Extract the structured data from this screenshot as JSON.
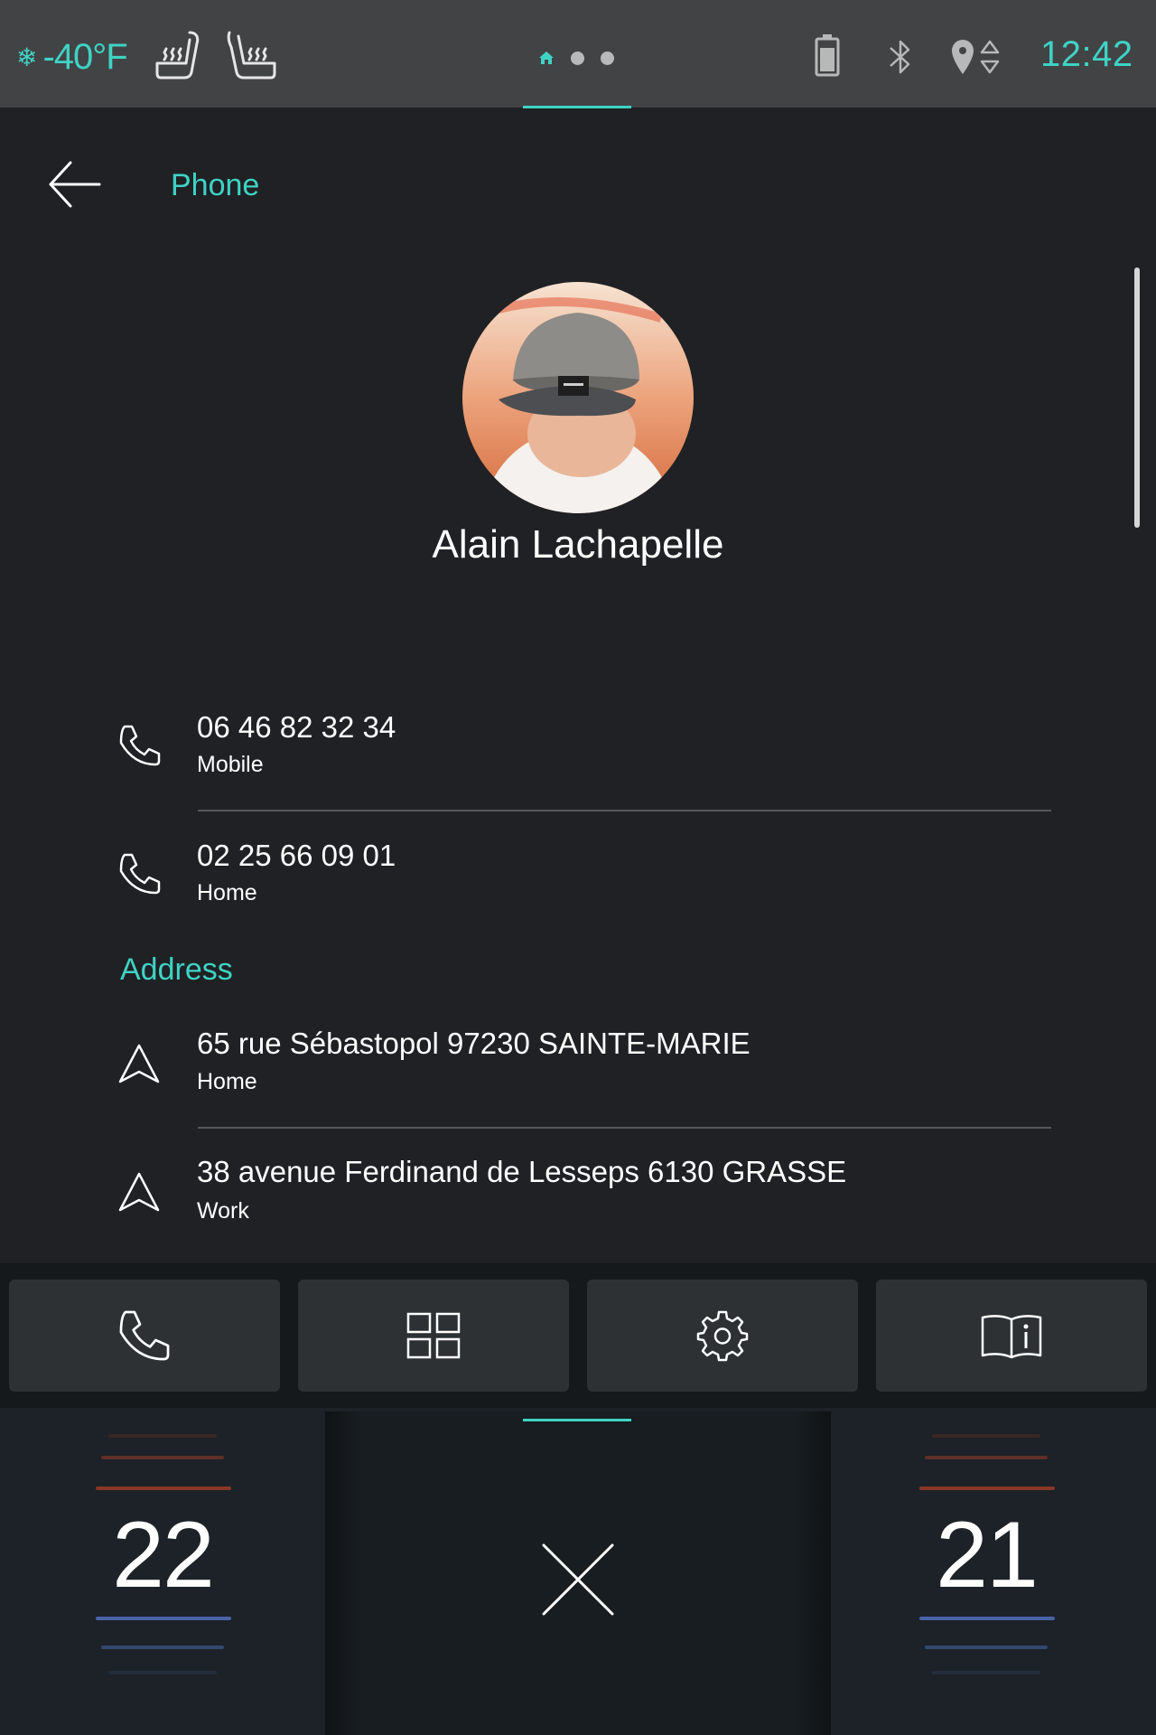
{
  "status_bar": {
    "outside_temp": "-40°F",
    "clock": "12:42",
    "pages": 3,
    "active_page": 1,
    "icons": [
      "snowflake-icon",
      "heated-seat-icon",
      "heated-seat-icon",
      "home-icon",
      "battery-icon",
      "bluetooth-icon",
      "location-icon"
    ]
  },
  "header": {
    "title": "Phone"
  },
  "contact": {
    "name": "Alain Lachapelle",
    "phones": [
      {
        "number": "06 46 82 32 34",
        "type": "Mobile"
      },
      {
        "number": "02 25 66 09 01",
        "type": "Home"
      }
    ],
    "address_section_title": "Address",
    "addresses": [
      {
        "line": "65 rue Sébastopol 97230 SAINTE-MARIE",
        "type": "Home"
      },
      {
        "line": "38 avenue Ferdinand de Lesseps 6130 GRASSE",
        "type": "Work"
      }
    ]
  },
  "dock": {
    "buttons": [
      "phone-icon",
      "apps-grid-icon",
      "settings-gear-icon",
      "manual-book-icon"
    ]
  },
  "climate": {
    "left_temp": "22",
    "right_temp": "21",
    "center_icon": "close-icon"
  },
  "colors": {
    "accent": "#3fd3c4",
    "background": "#1f2124",
    "status_bar": "#424345",
    "heat": "#9a3a2a",
    "cool": "#4a63a8"
  }
}
